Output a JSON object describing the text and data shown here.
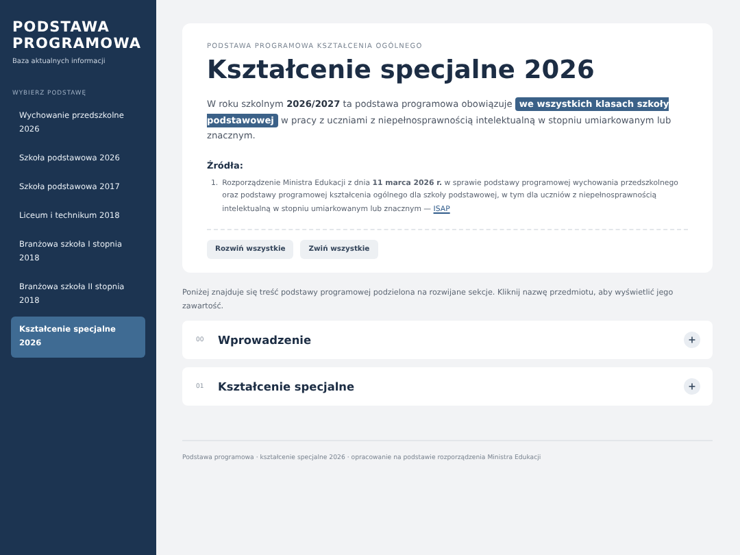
{
  "sidebar": {
    "title": "PODSTAWA PROGRAMOWA",
    "subtitle": "Baza aktualnych informacji",
    "section_label": "WYBIERZ PODSTAWĘ",
    "items": [
      {
        "label": "Wychowanie przedszkolne 2026",
        "selected": false
      },
      {
        "label": "Szkoła podstawowa 2026",
        "selected": false
      },
      {
        "label": "Szkoła podstawowa 2017",
        "selected": false
      },
      {
        "label": "Liceum i technikum 2018",
        "selected": false
      },
      {
        "label": "Branżowa szkoła I stopnia 2018",
        "selected": false
      },
      {
        "label": "Branżowa szkoła II stopnia 2018",
        "selected": false
      },
      {
        "label": "Kształcenie specjalne 2026",
        "selected": true
      }
    ]
  },
  "header": {
    "eyebrow": "PODSTAWA PROGRAMOWA KSZTAŁCENIA OGÓLNEGO",
    "title": "Kształcenie specjalne 2026",
    "intro_before": "W roku szkolnym **2026/2027** ta podstawa programowa obowiązuje",
    "intro_highlight": "we wszystkich klasach szkoły podstawowej",
    "intro_after": "w pracy z uczniami z niepełnosprawnością intelektualną w stopniu umiarkowanym lub znacznym.",
    "sources_heading": "Źródła:",
    "sources": [
      {
        "number": "1.",
        "text": "Rozporządzenie Ministra Edukacji z dnia **11 marca 2026 r.** w sprawie podstawy programowej wychowania przedszkolnego oraz podstawy programowej kształcenia ogólnego dla szkoły podstawowej, w tym dla uczniów z niepełnosprawnością intelektualną w stopniu umiarkowanym lub znacznym —",
        "link": "ISAP"
      }
    ],
    "buttons": [
      "Rozwiń wszystkie",
      "Zwiń wszystkie"
    ]
  },
  "note": "Poniżej znajduje się treść podstawy programowej podzielona na rozwijane sekcje. Kliknij nazwę przedmiotu, aby wyświetlić jego zawartość.",
  "sections": [
    {
      "number": "00",
      "title": "Wprowadzenie",
      "expanded": false
    },
    {
      "number": "01",
      "title": "Kształcenie specjalne",
      "expanded": false
    }
  ],
  "footer": "Podstawa programowa · kształcenie specjalne 2026 · opracowanie na podstawie rozporządzenia Ministra Edukacji"
}
